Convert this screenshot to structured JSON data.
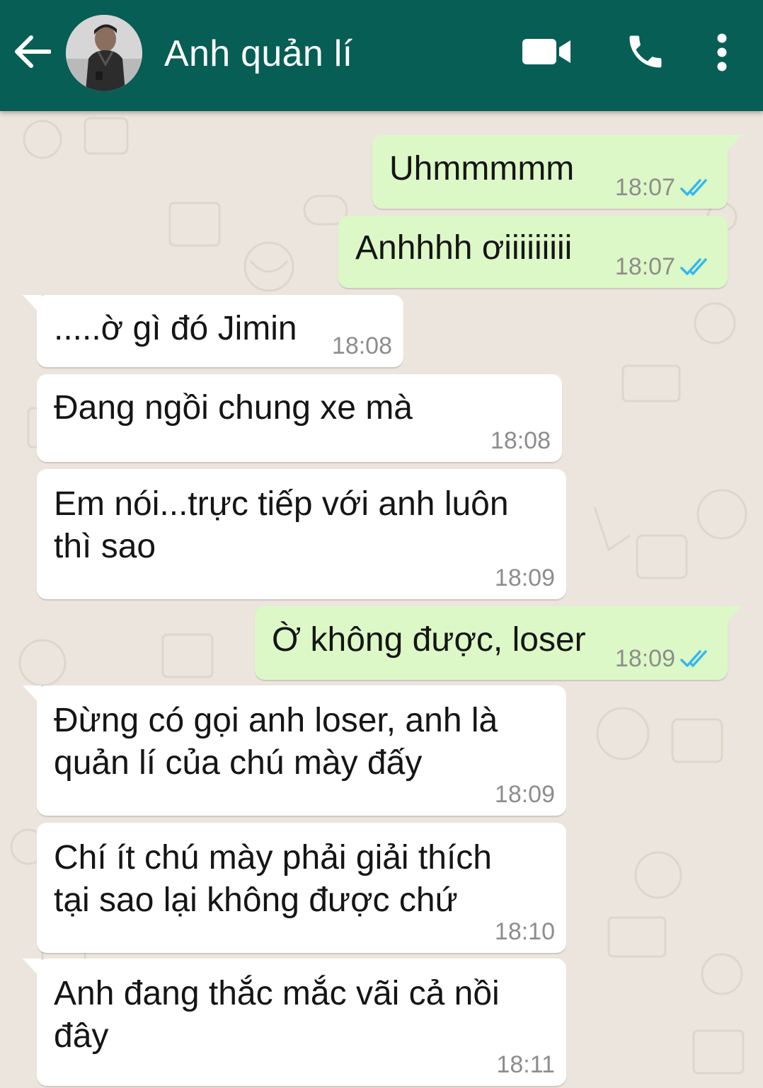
{
  "header": {
    "contact_name": "Anh quản lí",
    "colors": {
      "bar": "#075e54",
      "icons": "#ffffff"
    },
    "icons": [
      "back-arrow-icon",
      "avatar",
      "video-call-icon",
      "phone-icon",
      "more-vert-icon"
    ]
  },
  "chat": {
    "colors": {
      "outgoing": "#dcf8c6",
      "incoming": "#ffffff",
      "wallpaper": "#ece5dd",
      "read_ticks": "#34b7f1"
    },
    "messages": [
      {
        "dir": "out",
        "text": "Uhmmmmm",
        "time": "18:07",
        "status": "read"
      },
      {
        "dir": "out",
        "text": "Anhhhh ơiiiiiiiii",
        "time": "18:07",
        "status": "read"
      },
      {
        "dir": "in",
        "text": ".....ờ gì đó Jimin",
        "time": "18:08"
      },
      {
        "dir": "in",
        "text": "Đang ngồi chung xe mà",
        "time": "18:08"
      },
      {
        "dir": "in",
        "lines": [
          "Em nói...trực tiếp với anh luôn",
          "thì sao"
        ],
        "time": "18:09"
      },
      {
        "dir": "out",
        "text": "Ờ không được, loser",
        "time": "18:09",
        "status": "read"
      },
      {
        "dir": "in",
        "lines": [
          "Đừng có gọi anh loser, anh là",
          "quản lí của chú mày đấy"
        ],
        "time": "18:09"
      },
      {
        "dir": "in",
        "lines": [
          "Chí ít chú mày phải giải thích",
          "tại sao lại không được chứ"
        ],
        "time": "18:10"
      },
      {
        "dir": "in",
        "lines": [
          "Anh đang thắc mắc vãi cả nồi",
          "đây"
        ],
        "time": "18:11"
      }
    ]
  }
}
